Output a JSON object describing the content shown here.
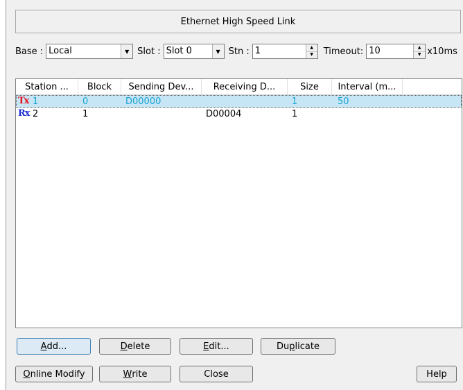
{
  "dialog": {
    "title": "Ethernet High Speed Link"
  },
  "controls": {
    "base_label": "Base :",
    "base_value": "Local",
    "slot_label": "Slot :",
    "slot_value": "Slot 0",
    "stn_label": "Stn :",
    "stn_value": "1",
    "timeout_label": "Timeout:",
    "timeout_value": "10",
    "timeout_unit": "x10ms"
  },
  "table": {
    "columns": [
      "Station ...",
      "Block",
      "Sending Dev...",
      "Receiving D...",
      "Size",
      "Interval (m..."
    ],
    "rows": [
      {
        "type": "Tx",
        "station": "1",
        "block": "0",
        "sending": "D00000",
        "receiving": "",
        "size": "1",
        "interval": "50",
        "selected": true
      },
      {
        "type": "Rx",
        "station": "2",
        "block": "1",
        "sending": "",
        "receiving": "D00004",
        "size": "1",
        "interval": "",
        "selected": false
      }
    ]
  },
  "buttons": {
    "add": {
      "pre": "",
      "key": "A",
      "post": "dd..."
    },
    "delete": {
      "pre": "",
      "key": "D",
      "post": "elete"
    },
    "edit": {
      "pre": "",
      "key": "E",
      "post": "dit..."
    },
    "duplicate": {
      "pre": "Du",
      "key": "p",
      "post": "licate"
    },
    "online_modify": {
      "pre": "",
      "key": "O",
      "post": "nline Modify"
    },
    "write": {
      "pre": "",
      "key": "W",
      "post": "rite"
    },
    "close": {
      "pre": "",
      "key": "",
      "post": "Close"
    },
    "help": {
      "pre": "",
      "key": "",
      "post": "Help"
    }
  },
  "icons": {
    "combo_arrow": "chevron-down-icon",
    "spin": "spin-up-down-icon"
  },
  "colors": {
    "tx_badge": "#e8101a",
    "rx_badge": "#1f2fd6",
    "selected_row": "#c6e6f6",
    "selected_text": "#1aa3d1"
  }
}
